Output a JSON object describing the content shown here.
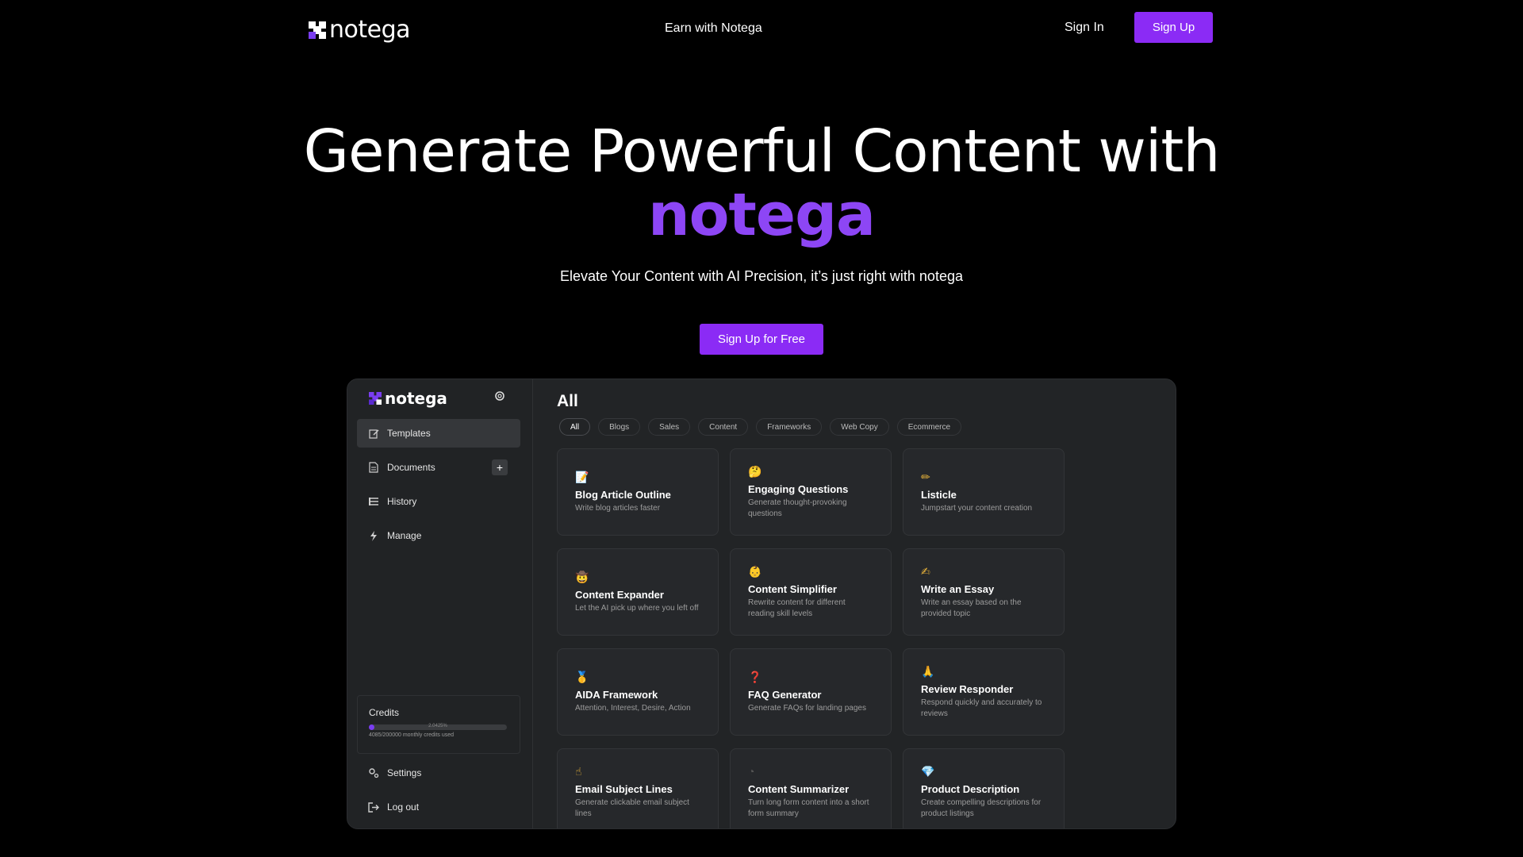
{
  "nav": {
    "brand": "notega",
    "earn": "Earn with Notega",
    "sign_in": "Sign In",
    "sign_up": "Sign Up"
  },
  "hero": {
    "title": "Generate Powerful Content with",
    "brand": "notega",
    "subtitle": "Elevate Your Content with AI Precision, it’s just right with notega",
    "cta": "Sign Up for Free"
  },
  "colors": {
    "accent": "#8b2bf5",
    "brand_text": "#8d46f5",
    "background": "#000000",
    "panel": "#222426"
  },
  "app": {
    "brand": "notega",
    "sidebar": {
      "items": [
        {
          "label": "Templates",
          "icon": "edit-icon"
        },
        {
          "label": "Documents",
          "icon": "document-icon"
        },
        {
          "label": "History",
          "icon": "list-icon"
        },
        {
          "label": "Manage",
          "icon": "bolt-icon"
        }
      ],
      "credits": {
        "title": "Credits",
        "percent_label": "2.0425%",
        "percent": 2.0425,
        "used": "4085/200000 monthly credits used"
      },
      "settings": "Settings",
      "logout": "Log out"
    },
    "main": {
      "title": "All",
      "filters": [
        "All",
        "Blogs",
        "Sales",
        "Content",
        "Frameworks",
        "Web Copy",
        "Ecommerce"
      ],
      "cards": [
        {
          "emoji": "📝",
          "title": "Blog Article Outline",
          "desc": "Write blog articles faster"
        },
        {
          "emoji": "🤔",
          "title": "Engaging Questions",
          "desc": "Generate thought-provoking questions"
        },
        {
          "emoji": "✏",
          "title": "Listicle",
          "desc": "Jumpstart your content creation"
        },
        {
          "emoji": "🤠",
          "title": "Content Expander",
          "desc": "Let the AI pick up where you left off"
        },
        {
          "emoji": "👶",
          "title": "Content Simplifier",
          "desc": "Rewrite content for different reading skill levels"
        },
        {
          "emoji": "✍",
          "title": "Write an Essay",
          "desc": "Write an essay based on the provided topic"
        },
        {
          "emoji": "🥇",
          "title": "AIDA Framework",
          "desc": "Attention, Interest, Desire, Action"
        },
        {
          "emoji": "❓",
          "title": "FAQ Generator",
          "desc": "Generate FAQs for landing pages"
        },
        {
          "emoji": "🙏",
          "title": "Review Responder",
          "desc": "Respond quickly and accurately to reviews"
        },
        {
          "emoji": "☝",
          "title": "Email Subject Lines",
          "desc": "Generate clickable email subject lines"
        },
        {
          "emoji": "◔",
          "title": "Content Summarizer",
          "desc": "Turn long form content into a short form summary"
        },
        {
          "emoji": "💎",
          "title": "Product Description",
          "desc": "Create compelling descriptions for product listings"
        }
      ]
    }
  }
}
